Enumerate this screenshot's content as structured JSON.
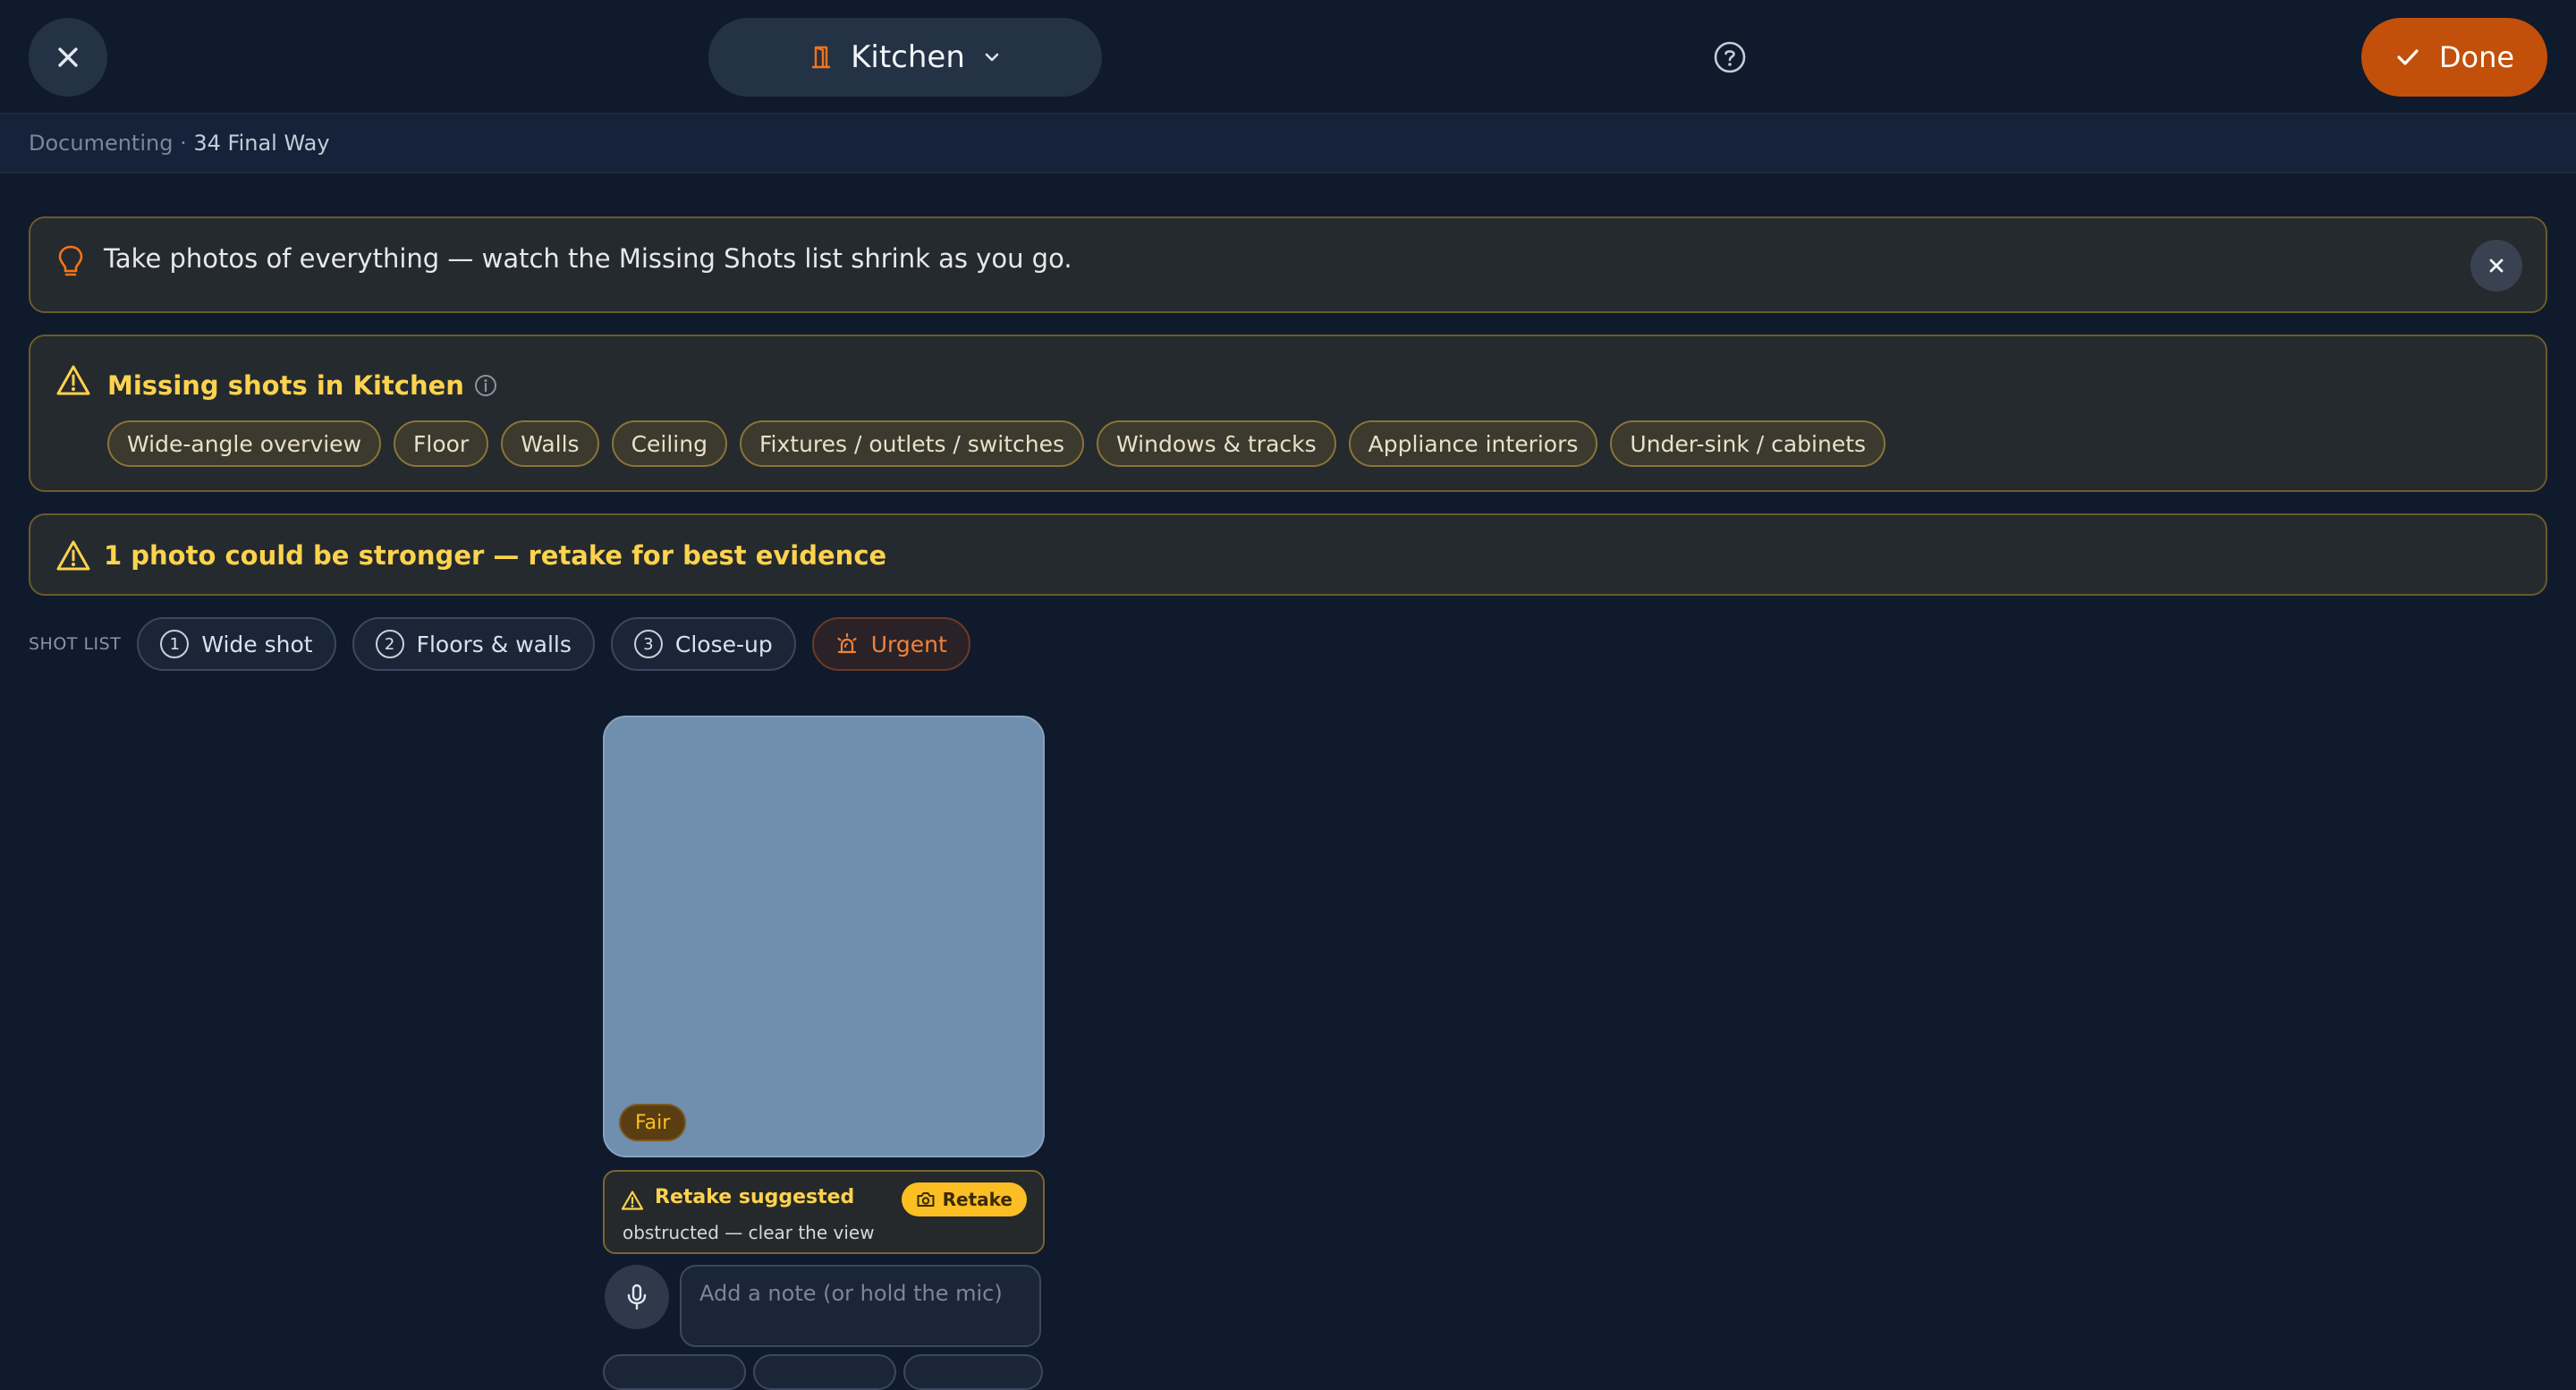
{
  "header": {
    "close_icon": "close-icon",
    "room_icon": "door-icon",
    "room_name": "Kitchen",
    "dropdown_icon": "chevron-down-icon",
    "help_icon": "help-circle-icon",
    "done_label": "Done",
    "done_icon": "check-icon"
  },
  "subheader": {
    "status": "Documenting · ",
    "address": "34 Final Way"
  },
  "tip": {
    "icon": "lightbulb-icon",
    "text": "Take photos of everything — watch the Missing Shots list shrink as you go.",
    "dismiss_icon": "close-icon"
  },
  "missing_shots": {
    "icon": "warning-icon",
    "title": "Missing shots in Kitchen",
    "info_icon": "info-icon",
    "chips": [
      "Wide-angle overview",
      "Floor",
      "Walls",
      "Ceiling",
      "Fixtures / outlets / switches",
      "Windows & tracks",
      "Appliance interiors",
      "Under-sink / cabinets"
    ]
  },
  "retake_banner": {
    "icon": "warning-icon",
    "text": "1 photo could be stronger — retake for best evidence"
  },
  "shot_list": {
    "label": "SHOT LIST",
    "items": [
      {
        "num": "1",
        "label": "Wide shot"
      },
      {
        "num": "2",
        "label": "Floors & walls"
      },
      {
        "num": "3",
        "label": "Close-up"
      }
    ],
    "urgent_label": "Urgent",
    "urgent_icon": "siren-icon"
  },
  "photo_card": {
    "quality_badge": "Fair",
    "retake_title": "Retake suggested",
    "retake_reason": "obstructed — clear the view",
    "retake_button": "Retake",
    "retake_icon": "camera-icon",
    "mic_icon": "mic-icon",
    "note_placeholder": "Add a note (or hold the mic)",
    "colors": {
      "accent": "#c2500a",
      "warning": "#fcd34d",
      "photo_placeholder": "#708ead"
    }
  }
}
